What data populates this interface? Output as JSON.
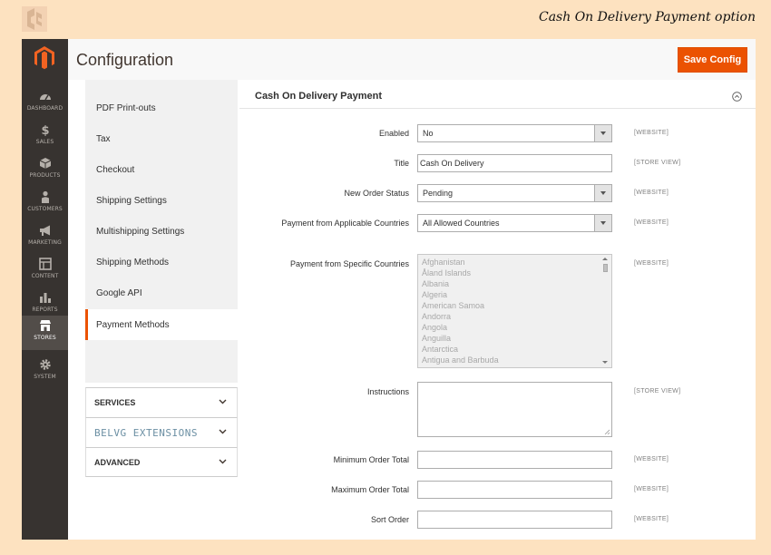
{
  "banner": {
    "title": "Cash On Delivery Payment option"
  },
  "nav": [
    {
      "key": "dashboard",
      "label": "DASHBOARD",
      "icon": "dashboard-icon"
    },
    {
      "key": "sales",
      "label": "SALES",
      "icon": "dollar-icon"
    },
    {
      "key": "products",
      "label": "PRODUCTS",
      "icon": "cube-icon"
    },
    {
      "key": "customers",
      "label": "CUSTOMERS",
      "icon": "person-icon"
    },
    {
      "key": "marketing",
      "label": "MARKETING",
      "icon": "megaphone-icon"
    },
    {
      "key": "content",
      "label": "CONTENT",
      "icon": "layout-icon"
    },
    {
      "key": "reports",
      "label": "REPORTS",
      "icon": "bar-chart-icon"
    },
    {
      "key": "stores",
      "label": "STORES",
      "icon": "store-icon",
      "active": true
    },
    {
      "key": "system",
      "label": "SYSTEM",
      "icon": "gear-icon"
    }
  ],
  "header": {
    "title": "Configuration",
    "save_label": "Save Config"
  },
  "tabs": [
    {
      "label": "PDF Print-outs"
    },
    {
      "label": "Tax"
    },
    {
      "label": "Checkout"
    },
    {
      "label": "Shipping Settings"
    },
    {
      "label": "Multishipping Settings"
    },
    {
      "label": "Shipping Methods"
    },
    {
      "label": "Google API"
    },
    {
      "label": "Payment Methods",
      "active": true
    }
  ],
  "groups": [
    {
      "label": "SERVICES"
    },
    {
      "label": "BELVG EXTENSIONS"
    },
    {
      "label": "ADVANCED"
    }
  ],
  "section": {
    "title": "Cash On Delivery Payment"
  },
  "fields": {
    "enabled": {
      "label": "Enabled",
      "value": "No",
      "scope": "[WEBSITE]"
    },
    "title": {
      "label": "Title",
      "value": "Cash On Delivery",
      "scope": "[STORE VIEW]"
    },
    "order_status": {
      "label": "New Order Status",
      "value": "Pending",
      "scope": "[WEBSITE]"
    },
    "allowed_countries": {
      "label": "Payment from Applicable Countries",
      "value": "All Allowed Countries",
      "scope": "[WEBSITE]"
    },
    "specific_countries": {
      "label": "Payment from Specific Countries",
      "scope": "[WEBSITE]",
      "options": [
        "Afghanistan",
        "Åland Islands",
        "Albania",
        "Algeria",
        "American Samoa",
        "Andorra",
        "Angola",
        "Anguilla",
        "Antarctica",
        "Antigua and Barbuda"
      ]
    },
    "instructions": {
      "label": "Instructions",
      "value": "",
      "scope": "[STORE VIEW]"
    },
    "min_total": {
      "label": "Minimum Order Total",
      "value": "",
      "scope": "[WEBSITE]"
    },
    "max_total": {
      "label": "Maximum Order Total",
      "value": "",
      "scope": "[WEBSITE]"
    },
    "sort_order": {
      "label": "Sort Order",
      "value": "",
      "scope": "[WEBSITE]"
    }
  },
  "colors": {
    "accent": "#eb5202",
    "sidebar": "#373330",
    "background": "#fde2c0"
  }
}
